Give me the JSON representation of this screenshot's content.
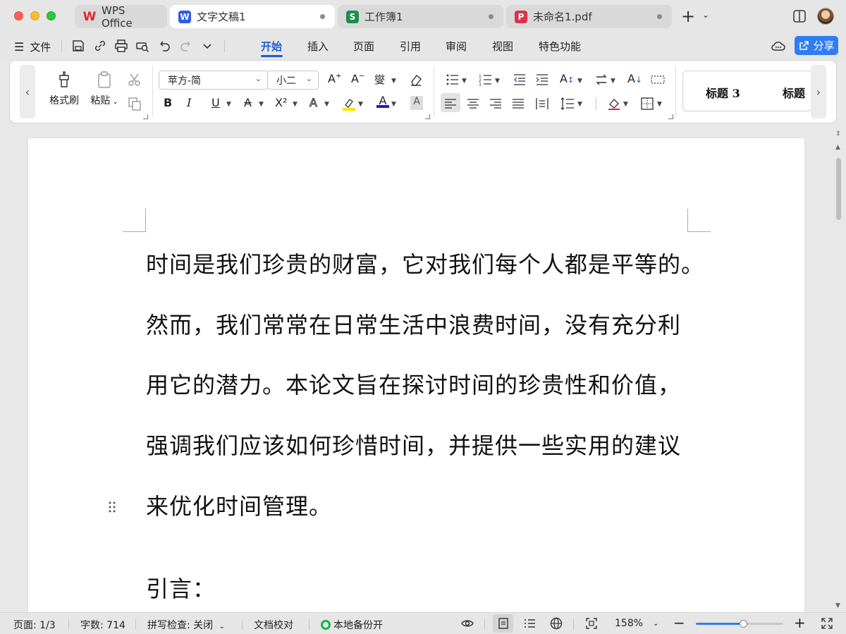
{
  "tabs": [
    {
      "label": "WPS Office",
      "logo": "W",
      "logo_color": "#e3262f",
      "active": false
    },
    {
      "label": "文字文稿1",
      "logo": "W",
      "logo_color": "#2f5bea",
      "active": true
    },
    {
      "label": "工作簿1",
      "logo": "S",
      "logo_color": "#1a8e4b",
      "active": false
    },
    {
      "label": "未命名1.pdf",
      "logo": "P",
      "logo_color": "#d9334a",
      "active": false
    }
  ],
  "tab_add": "+",
  "menu": {
    "file": "文件",
    "tabs": [
      "开始",
      "插入",
      "页面",
      "引用",
      "审阅",
      "视图",
      "特色功能"
    ],
    "active_tab": "开始",
    "share": "分享"
  },
  "ribbon": {
    "format_painter": "格式刷",
    "paste": "粘贴",
    "font_name": "苹方-简",
    "font_size": "小二",
    "styles": [
      "标题 3",
      "标题"
    ]
  },
  "document": {
    "paragraphs": [
      "时间是我们珍贵的财富，它对我们每个人都是平等的。",
      "然而，我们常常在日常生活中浪费时间，没有充分利",
      "用它的潜力。本论文旨在探讨时间的珍贵性和价值，",
      "强调我们应该如何珍惜时间，并提供一些实用的建议",
      "来优化时间管理。",
      "引言："
    ]
  },
  "status": {
    "page": "页面: 1/3",
    "word_count": "字数: 714",
    "spell_check": "拼写检查: 关闭",
    "proofread": "文档校对",
    "backup": "本地备份开",
    "zoom": "158%",
    "zoom_slider_fraction": 0.55
  },
  "colors": {
    "accent": "#1e5bd6",
    "share_button": "#2f7cf6",
    "backup_indicator": "#19b34a"
  }
}
